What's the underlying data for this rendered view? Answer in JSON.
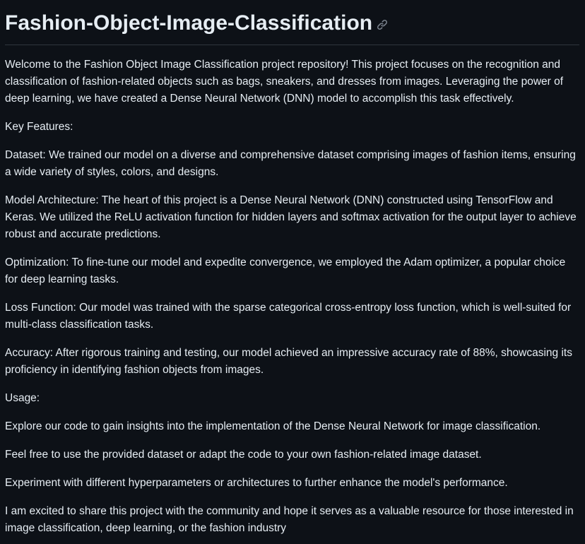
{
  "readme": {
    "title": "Fashion-Object-Image-Classification",
    "paragraphs": [
      "Welcome to the Fashion Object Image Classification project repository! This project focuses on the recognition and classification of fashion-related objects such as bags, sneakers, and dresses from images. Leveraging the power of deep learning, we have created a Dense Neural Network (DNN) model to accomplish this task effectively.",
      "Key Features:",
      "Dataset: We trained our model on a diverse and comprehensive dataset comprising images of fashion items, ensuring a wide variety of styles, colors, and designs.",
      "Model Architecture: The heart of this project is a Dense Neural Network (DNN) constructed using TensorFlow and Keras. We utilized the ReLU activation function for hidden layers and softmax activation for the output layer to achieve robust and accurate predictions.",
      "Optimization: To fine-tune our model and expedite convergence, we employed the Adam optimizer, a popular choice for deep learning tasks.",
      "Loss Function: Our model was trained with the sparse categorical cross-entropy loss function, which is well-suited for multi-class classification tasks.",
      "Accuracy: After rigorous training and testing, our model achieved an impressive accuracy rate of 88%, showcasing its proficiency in identifying fashion objects from images.",
      "Usage:",
      "Explore our code to gain insights into the implementation of the Dense Neural Network for image classification.",
      "Feel free to use the provided dataset or adapt the code to your own fashion-related image dataset.",
      "Experiment with different hyperparameters or architectures to further enhance the model's performance.",
      "I am excited to share this project with the community and hope it serves as a valuable resource for those interested in image classification, deep learning, or the fashion industry"
    ]
  },
  "icons": {
    "anchor": "link-icon"
  },
  "colors": {
    "background": "#0d1117",
    "text": "#e6edf3",
    "divider": "#30363d",
    "icon": "#7d8590"
  }
}
